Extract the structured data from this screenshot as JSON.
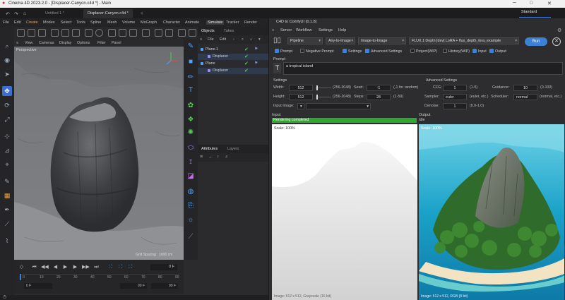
{
  "titlebar": {
    "title": "Cinema 4D 2023.2.0 - [Displacer-Canyon.c4d *] - Main"
  },
  "tabs": [
    {
      "label": "Untitled 1 *"
    },
    {
      "label": "Displacer-Canyon.c4d *"
    }
  ],
  "layout": {
    "label": "Standard"
  },
  "menubar": [
    "File",
    "Edit",
    "Create",
    "Modes",
    "Select",
    "Tools",
    "Spline",
    "Mesh",
    "Volume",
    "MoGraph",
    "Character",
    "Animate",
    "Simulate",
    "Tracker",
    "Render"
  ],
  "viewport": {
    "menu": [
      "View",
      "Cameras",
      "Display",
      "Options",
      "Filter",
      "Panel"
    ],
    "label": "Perspective",
    "grid_spacing": "Grid Spacing : 1000 cm"
  },
  "objects": {
    "tabs": [
      "Objects",
      "Takes"
    ],
    "menu": [
      "File",
      "Edit"
    ],
    "items": [
      {
        "name": "Plane.1",
        "indent": 0
      },
      {
        "name": "Displacer",
        "indent": 1
      },
      {
        "name": "Plane",
        "indent": 0
      },
      {
        "name": "Displacer",
        "indent": 1
      }
    ]
  },
  "attributes": {
    "tabs": [
      "Attributes",
      "Layers"
    ]
  },
  "timeline": {
    "current_frame": "0 F",
    "ruler": [
      "0",
      "10",
      "20",
      "30",
      "40",
      "50",
      "60",
      "70",
      "80",
      "90"
    ],
    "start": "0 F",
    "end": "90 F",
    "max": "90 F"
  },
  "comfy": {
    "title": "C4D to ComfyUI (0.1.8)",
    "menu": [
      "Server",
      "Workflow",
      "Settings",
      "Help"
    ],
    "pipeline": "Pipeline",
    "mode": "Any-to-Image",
    "task": "Image-to-Image",
    "model": "FLUX.1 Depth [dev] LoRA + flux_depth_lora_example",
    "run_label": "Run",
    "checkboxes": [
      {
        "label": "Prompt",
        "on": true
      },
      {
        "label": "Negative Prompt",
        "on": false
      },
      {
        "label": "Settings",
        "on": true
      },
      {
        "label": "Advanced Settings",
        "on": true
      },
      {
        "label": "Project(WIP)",
        "on": false
      },
      {
        "label": "History(WIP)",
        "on": false
      },
      {
        "label": "Input",
        "on": true
      },
      {
        "label": "Output",
        "on": true
      }
    ],
    "prompt_label": "Prompt",
    "prompt_text": "a tropical island",
    "settings": {
      "title": "Settings",
      "width_label": "Width:",
      "width": "512",
      "width_range": "(256-2048)",
      "height_label": "Height:",
      "height": "512",
      "height_range": "(256-2048)",
      "seed_label": "Seed:",
      "seed": "-1",
      "seed_hint": "(-1 for random)",
      "steps_label": "Steps:",
      "steps": "28",
      "steps_range": "(1-50)",
      "input_image_label": "Input Image:"
    },
    "advanced": {
      "title": "Advanced Settings",
      "cfg_label": "CFG:",
      "cfg": "1",
      "cfg_range": "(1-5)",
      "guidance_label": "Guidance:",
      "guidance": "10",
      "guidance_range": "(0-100)",
      "sampler_label": "Sampler:",
      "sampler": "euler",
      "sampler_hint": "(euler, etc.)",
      "scheduler_label": "Scheduler:",
      "scheduler": "normal",
      "scheduler_hint": "(normal, etc.)",
      "denoise_label": "Denoise:",
      "denoise": "1",
      "denoise_range": "(0.0-1.0)"
    },
    "input": {
      "title": "Input",
      "status": "Rendering completed",
      "progress": 1.0,
      "scale": "Scale: 100%",
      "info": "Image: 512 x 512, Grayscale (16 bit)"
    },
    "output": {
      "title": "Output",
      "status": "Idle",
      "scale": "Scale: 100%",
      "info": "Image: 512 x 512, RGB (8 bit)"
    }
  }
}
